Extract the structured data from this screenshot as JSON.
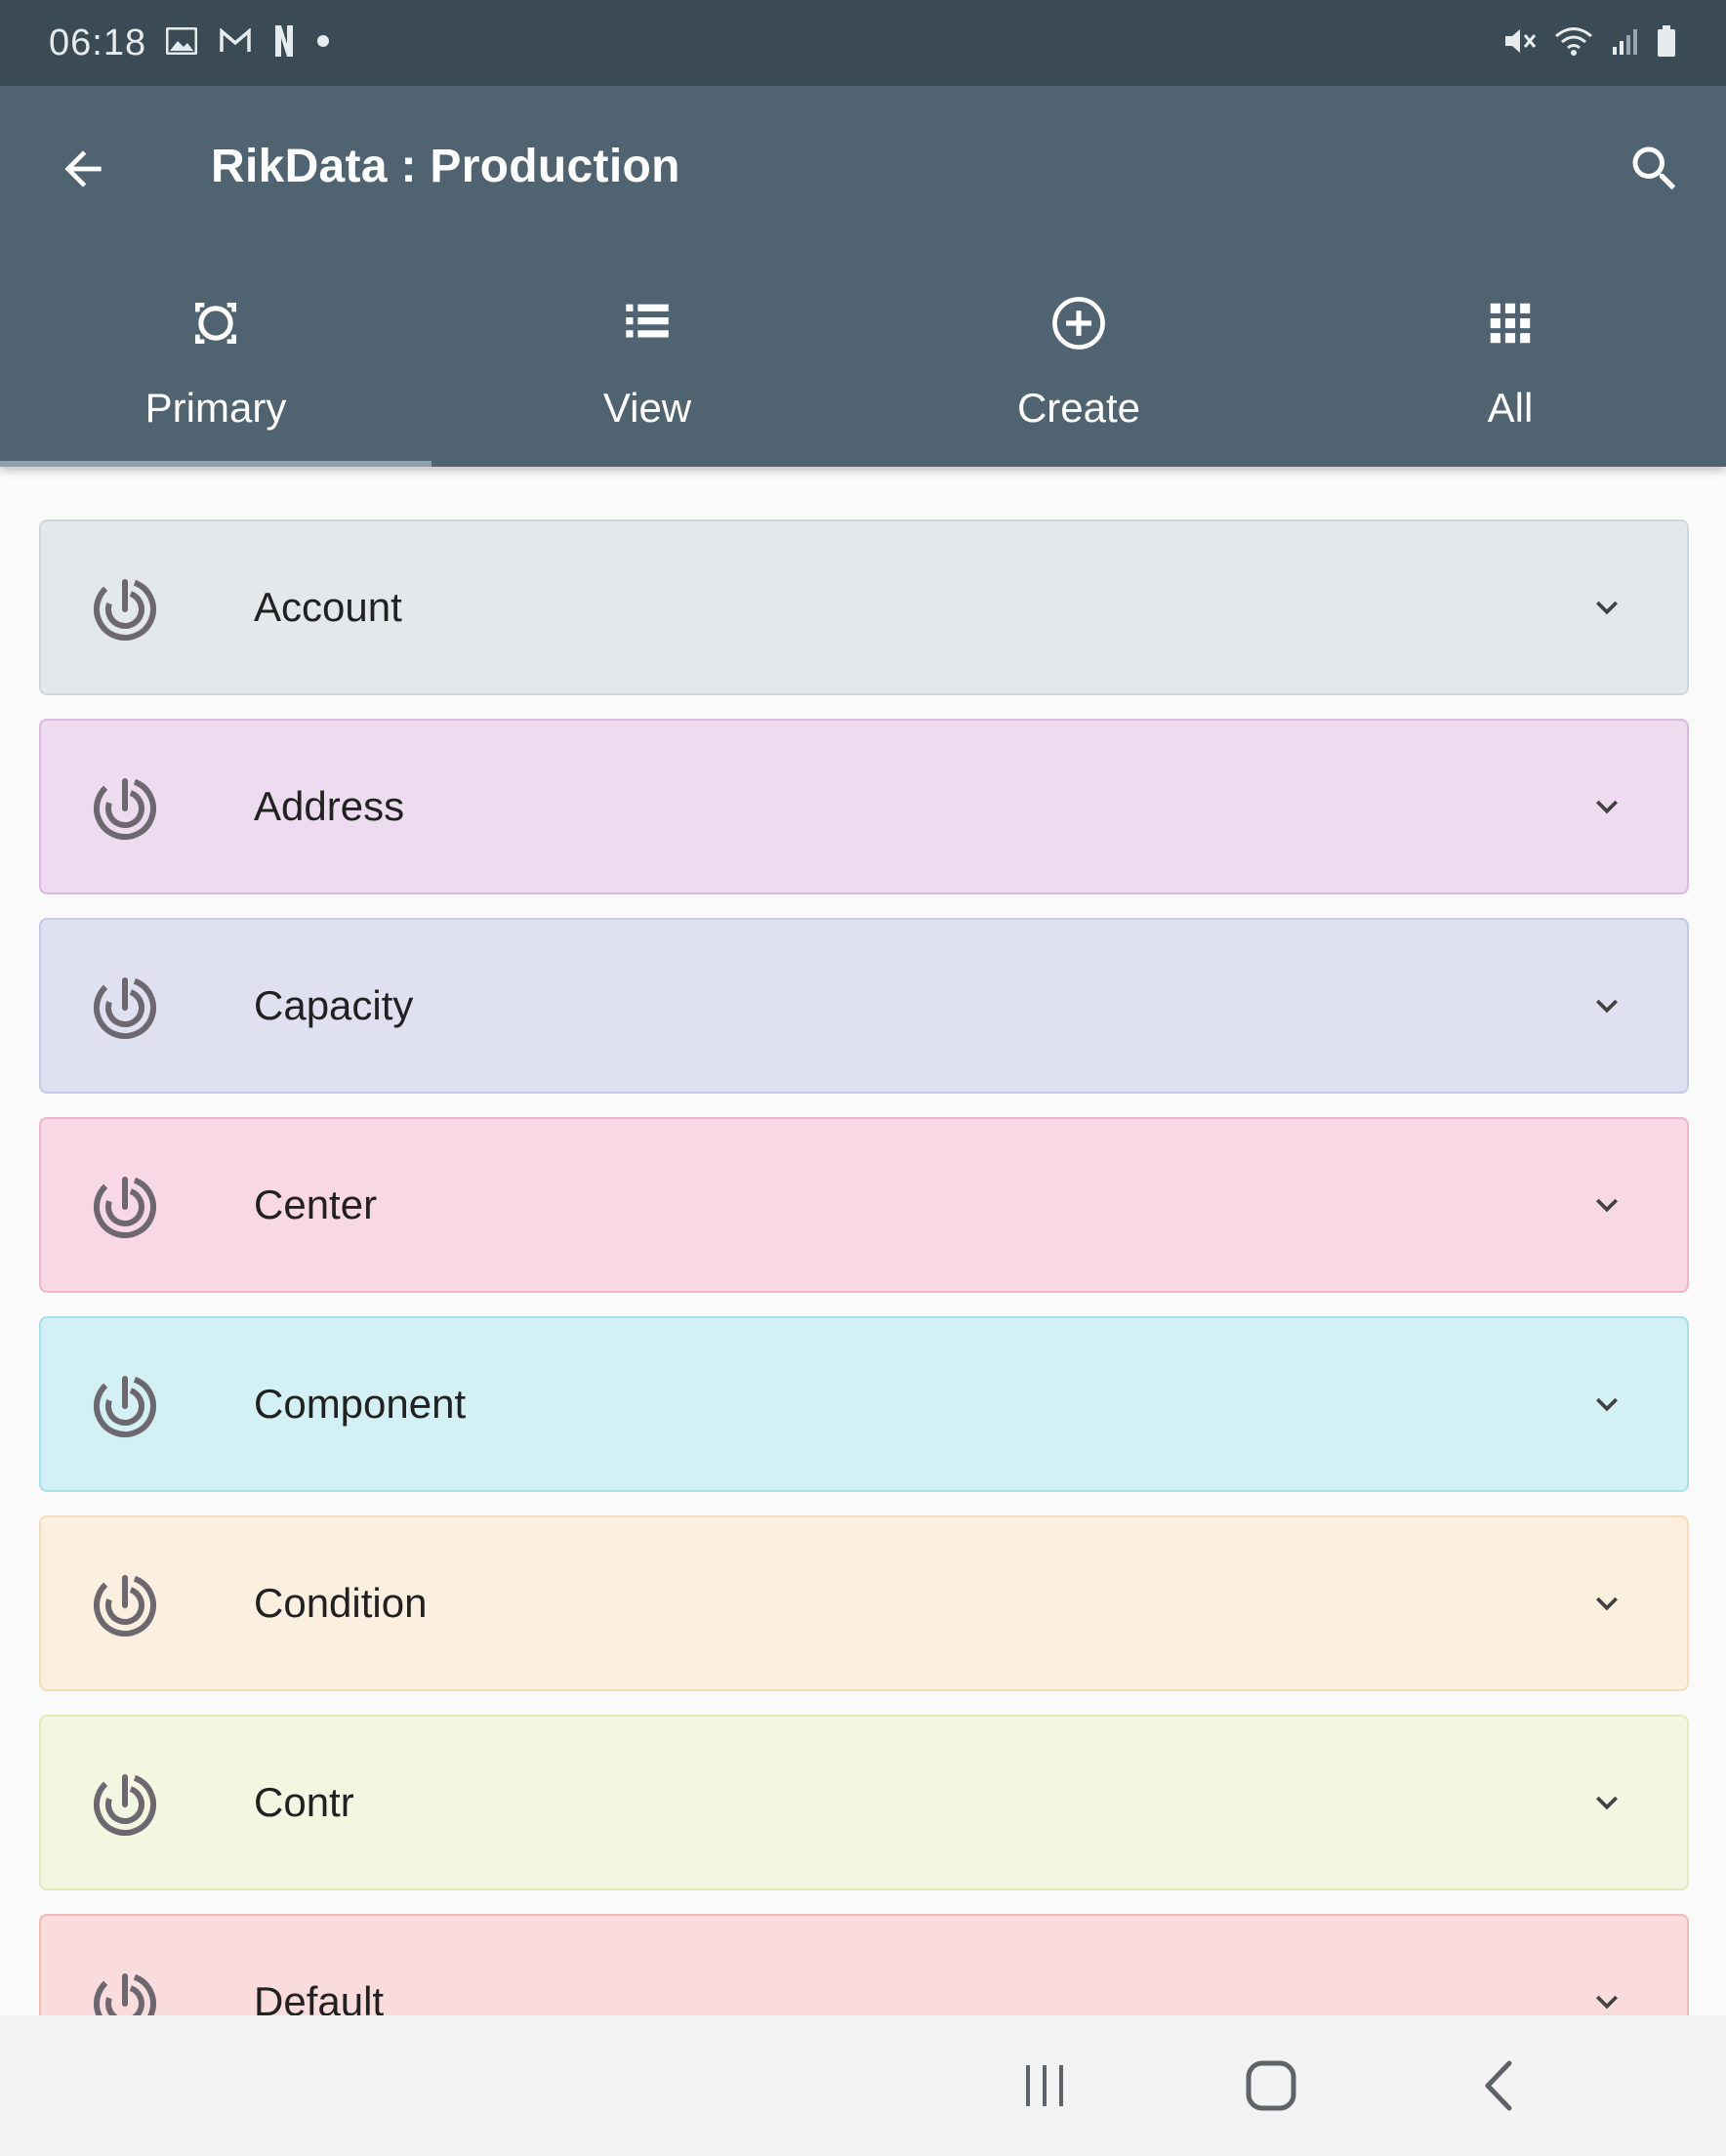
{
  "status_bar": {
    "time": "06:18",
    "left_icons": [
      "image-icon",
      "gmail-icon",
      "netflix-icon",
      "dot-icon"
    ],
    "right_icons": [
      "mute-icon",
      "wifi-icon",
      "signal-icon",
      "battery-icon"
    ]
  },
  "app_bar": {
    "title": "RikData : Production",
    "back_icon": "arrow-left-icon",
    "search_icon": "search-icon"
  },
  "tabs": [
    {
      "label": "Primary",
      "icon": "target-square-icon",
      "selected": true
    },
    {
      "label": "View",
      "icon": "list-icon",
      "selected": false
    },
    {
      "label": "Create",
      "icon": "add-circle-icon",
      "selected": false
    },
    {
      "label": "All",
      "icon": "grid-icon",
      "selected": false
    }
  ],
  "items": [
    {
      "label": "Account",
      "bg": "#e3e8eb",
      "border": "#cfd7dc"
    },
    {
      "label": "Address",
      "bg": "#eddbef",
      "border": "#dcb9e2"
    },
    {
      "label": "Capacity",
      "bg": "#dfe0f0",
      "border": "#c5c8e6"
    },
    {
      "label": "Center",
      "bg": "#f8d8e4",
      "border": "#efb6cb"
    },
    {
      "label": "Component",
      "bg": "#d3f1f5",
      "border": "#a8e0e9"
    },
    {
      "label": "Condition",
      "bg": "#fbefe0",
      "border": "#f6dcbc"
    },
    {
      "label": "Contr",
      "bg": "#f3f6e1",
      "border": "#e3eabe"
    },
    {
      "label": "Default",
      "bg": "#fadcdc",
      "border": "#f3b9b9"
    }
  ],
  "nav_bar": {
    "icons": [
      "recent-apps-icon",
      "home-icon",
      "back-chevron-icon"
    ]
  }
}
